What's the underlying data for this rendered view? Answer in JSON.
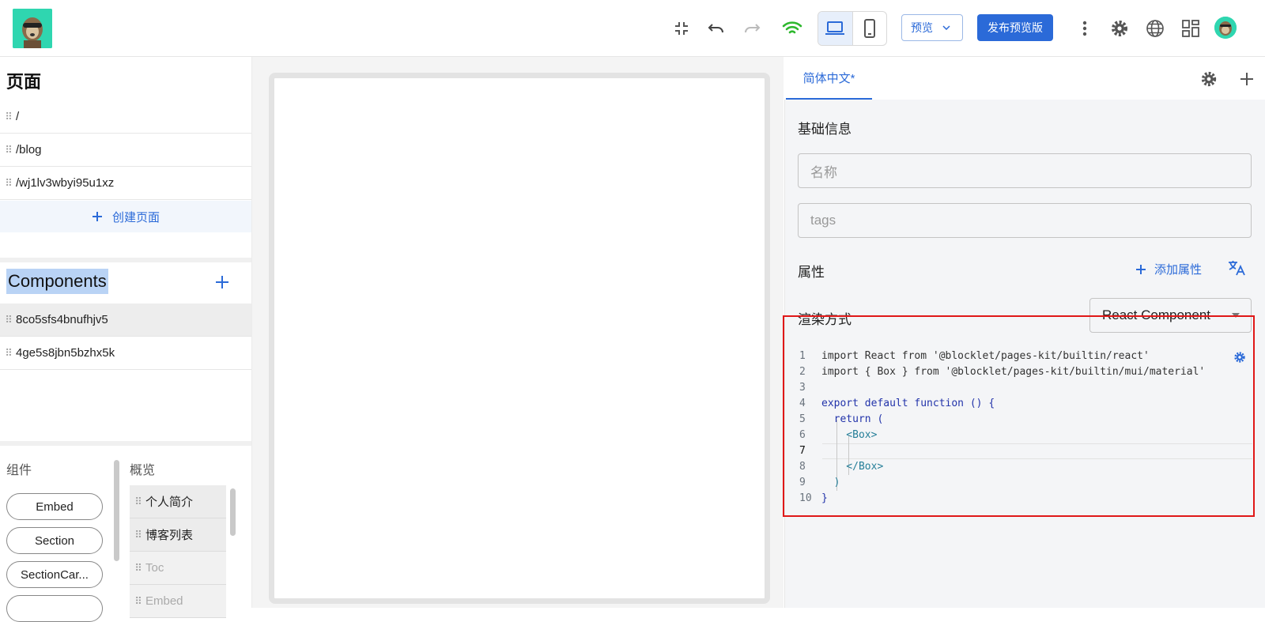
{
  "topbar": {
    "device_desktop": "desktop-icon",
    "device_mobile": "mobile-icon",
    "preview_select": "预览",
    "publish_button": "发布预览版"
  },
  "pages": {
    "title": "页面",
    "items": [
      "/",
      "/blog",
      "/wj1lv3wbyi95u1xz"
    ],
    "create_label": "创建页面"
  },
  "components": {
    "title": "Components",
    "items": [
      "8co5sfs4bnufhjv5",
      "4ge5s8jbn5bzhx5k"
    ]
  },
  "library": {
    "components_label": "组件",
    "overview_label": "概览",
    "pills": [
      "Embed",
      "Section",
      "SectionCar..."
    ],
    "overview_items": [
      "个人简介",
      "博客列表",
      "Toc",
      "Embed"
    ]
  },
  "right_panel": {
    "tab_label": "简体中文*",
    "basic_info_label": "基础信息",
    "name_placeholder": "名称",
    "tags_placeholder": "tags",
    "attributes_label": "属性",
    "add_attribute_label": "添加属性",
    "render_mode_label": "渲染方式",
    "render_mode_value": "React Component"
  },
  "code_editor": {
    "line_numbers": [
      "1",
      "2",
      "3",
      "4",
      "5",
      "6",
      "7",
      "8",
      "9",
      "10"
    ],
    "lines": [
      "import React from '@blocklet/pages-kit/builtin/react'",
      "import { Box } from '@blocklet/pages-kit/builtin/mui/material'",
      "",
      "export default function () {",
      "  return (",
      "    <Box>",
      "",
      "    </Box>",
      "  )",
      "}"
    ]
  },
  "colors": {
    "accent": "#2b6ad8",
    "highlight_box": "#e01818",
    "wifi": "#2eb82e"
  }
}
